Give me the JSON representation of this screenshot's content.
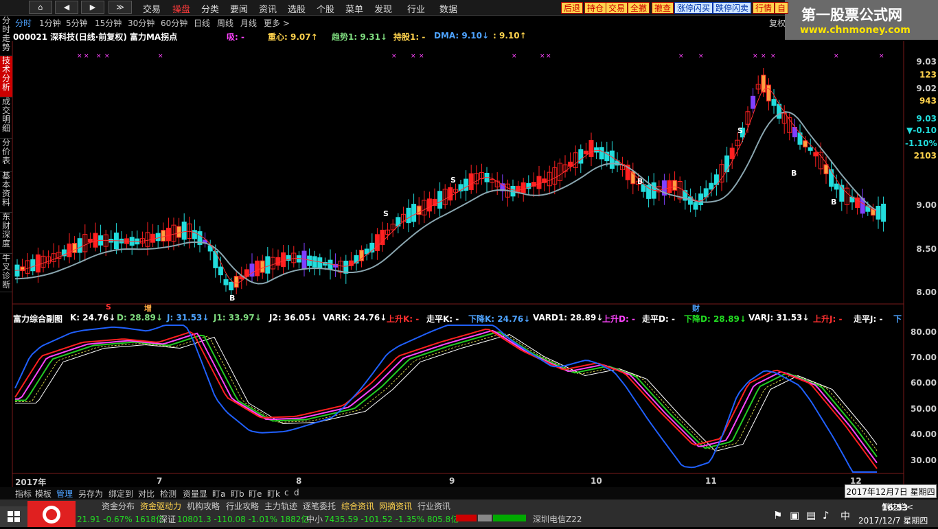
{
  "topbar": {
    "nav": [
      "⌂",
      "◀",
      "▶",
      "≫"
    ],
    "menus": [
      "交易",
      "操盘",
      "分类",
      "要闻",
      "资讯",
      "选股",
      "个股",
      "菜单",
      "发现",
      "行业",
      "数据"
    ],
    "active_menu": "操盘",
    "buttons": [
      "后退",
      "持仓",
      "交易",
      "全撤",
      "撤查",
      "涨停闪买",
      "跌停闪卖",
      "行情",
      "自"
    ]
  },
  "brand": {
    "title": "第一股票公式网",
    "url": "www.chnmoney.com"
  },
  "left_tabs": [
    "分时走势",
    "技术分析",
    "成交明细",
    "分价表",
    "基本资料",
    "东财深度",
    "牛叉诊断"
  ],
  "periods": [
    "分时",
    "1分钟",
    "5分钟",
    "15分钟",
    "30分钟",
    "60分钟",
    "日线",
    "周线",
    "月线",
    "更多 >"
  ],
  "restore_label": "复权",
  "info": {
    "code_name": "000021  深科技(日线·前复权) 富力MA拐点",
    "xi": "吸: -",
    "zhongxin": "重心: 9.07↑",
    "trend": "趋势1: 9.31↓",
    "hold": "持股1: -",
    "dma": "DMA: 9.10↓",
    "extra": ": 9.10↑"
  },
  "price_axis": [
    "9.03",
    "123",
    "9.02",
    "943",
    "9.03",
    "▼-0.10",
    "-1.10%",
    "2103",
    "9.00",
    "8.50",
    "8.00"
  ],
  "indicator": {
    "title": "富力综合副图",
    "items": [
      "K: 24.76↓",
      "D: 28.89↓",
      "J: 31.53↓",
      "J1: 33.97↓",
      "J2: 36.05↓",
      "VARK: 24.76↓",
      "上升K: -",
      "走平K: -",
      "下降K: 24.76↓",
      "VARD1: 28.89↓",
      "上升D: -",
      "走平D: -",
      "下降D: 28.89↓",
      "VARJ: 31.53↓",
      "上升J: -",
      "走平J: -",
      "下"
    ],
    "axis": [
      "80.00",
      "70.00",
      "60.00",
      "50.00",
      "40.00",
      "30.00"
    ]
  },
  "time_axis": [
    "2017年",
    "7",
    "8",
    "9",
    "10",
    "11",
    "12"
  ],
  "markers": {
    "s": "S",
    "b": "B",
    "zeng": "增",
    "cai": "财"
  },
  "bottom_tabs": [
    "指标",
    "模板",
    "管理",
    "另存为",
    "绑定到",
    "对比",
    "检测",
    "资量显",
    "盯a",
    "盯b",
    "盯e",
    "盯k",
    "c",
    "d"
  ],
  "news_tabs": [
    "资金分布",
    "资金驱动力",
    "机构攻略",
    "行业攻略",
    "主力轨迹",
    "逐笔委托",
    "综合资讯",
    "网摘资讯",
    "行业资讯"
  ],
  "status": {
    "sh_idx": "21.91 -0.67% 1618亿",
    "sz_label": "深证",
    "sz_idx": "10801.3 -110.08 -1.01% 1882亿",
    "zx_label": "中小",
    "zx_idx": "7435.59 -101.52 -1.35% 805.8亿",
    "provider": "深圳电信Z22",
    "sidebar": "侧边栏<",
    "clock": "16:53",
    "date": "2017/12/7 星期四"
  },
  "date_tooltip": "2017年12月7日 星期四",
  "colors": {
    "up": "#ff2020",
    "down": "#22dddd",
    "ma1": "#8aa6b0",
    "ma2": "#ff3030",
    "k": "#ff2020",
    "d": "#ff44ff",
    "j": "#2060ff"
  }
}
